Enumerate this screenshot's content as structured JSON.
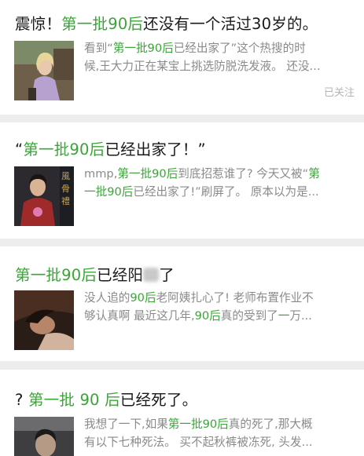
{
  "results": [
    {
      "title_parts": [
        {
          "text": "震惊！",
          "hl": false
        },
        {
          "text": "第一批90后",
          "hl": true
        },
        {
          "text": "还没有一个活过30岁的。",
          "hl": false
        }
      ],
      "thumb_icon": "woman-lilac-sweater-photo",
      "snippet_lines": [
        [
          {
            "text": "看到“",
            "hl": false
          },
          {
            "text": "第一批90后",
            "hl": true
          },
          {
            "text": "已经出家了”这个热搜的时",
            "hl": false
          }
        ],
        [
          {
            "text": "候,王大力正在某宝上挑选防脱洗发液。 还没...",
            "hl": false
          }
        ]
      ],
      "follow_label": "已关注"
    },
    {
      "title_parts": [
        {
          "text": "“",
          "hl": false
        },
        {
          "text": "第一批90后",
          "hl": true
        },
        {
          "text": "已经出家了！”",
          "hl": false
        }
      ],
      "thumb_icon": "woman-red-robe-photo",
      "snippet_lines": [
        [
          {
            "text": "mmp,",
            "hl": false
          },
          {
            "text": "第一批90后",
            "hl": true
          },
          {
            "text": "到底招惹谁了? 今天又被“",
            "hl": false
          },
          {
            "text": "第",
            "hl": true
          }
        ],
        [
          {
            "text": "一批90后",
            "hl": true
          },
          {
            "text": "已经出家了!”刷屏了。 原本以为是...",
            "hl": false
          }
        ]
      ]
    },
    {
      "title_parts": [
        {
          "text": "第一批90后",
          "hl": true
        },
        {
          "text": "已经阳",
          "hl": false
        },
        {
          "text": "",
          "blur": true
        },
        {
          "text": "了",
          "hl": false
        }
      ],
      "thumb_icon": "woman-dark-photo",
      "snippet_lines": [
        [
          {
            "text": "没人追的",
            "hl": false
          },
          {
            "text": "90后",
            "hl": true
          },
          {
            "text": "老阿姨扎心了! 老师布置作业不",
            "hl": false
          }
        ],
        [
          {
            "text": "够认真啊 最近这几年,",
            "hl": false
          },
          {
            "text": "90后",
            "hl": true
          },
          {
            "text": "真的受到了",
            "hl": false
          },
          {
            "text": "一",
            "hl": true
          },
          {
            "text": "万...",
            "hl": false
          }
        ]
      ]
    },
    {
      "title_parts": [
        {
          "text": "? ",
          "hl": false
        },
        {
          "text": "第一批 90 后",
          "hl": true
        },
        {
          "text": "已经死了。",
          "hl": false
        }
      ],
      "thumb_icon": "man-dark-photo",
      "snippet_lines": [
        [
          {
            "text": "我想了一下,如果",
            "hl": false
          },
          {
            "text": "第一批90后",
            "hl": true
          },
          {
            "text": "真的死了,那大概",
            "hl": false
          }
        ],
        [
          {
            "text": "有以下七种死法。 买不起秋裤被冻死, 头发...",
            "hl": false
          }
        ]
      ]
    }
  ]
}
